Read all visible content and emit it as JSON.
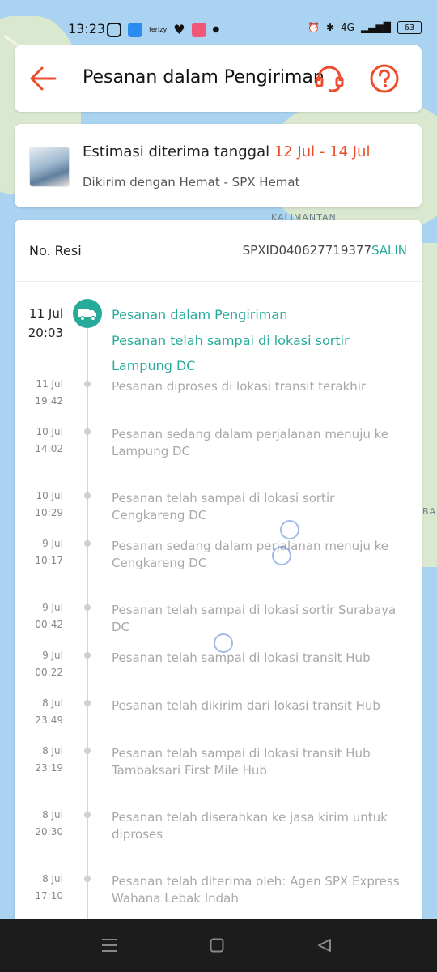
{
  "status_bar": {
    "time": "13:23",
    "network": "4G",
    "battery": "63"
  },
  "header": {
    "title": "Pesanan dalam Pengiriman"
  },
  "estimate": {
    "prefix": "Estimasi diterima tanggal",
    "date_range": "12 Jul - 14 Jul",
    "shipping": "Dikirim dengan Hemat - SPX Hemat"
  },
  "resi": {
    "label": "No. Resi",
    "number": "SPXID040627719377",
    "copy_label": "SALIN"
  },
  "current": {
    "day": "11 Jul",
    "time": "20:03",
    "status": "Pesanan dalam Pengiriman",
    "detail": "Pesanan telah sampai di lokasi sortir Lampung DC"
  },
  "events": [
    {
      "day": "11 Jul",
      "time": "19:42",
      "text": "Pesanan diproses di lokasi transit terakhir"
    },
    {
      "day": "10 Jul",
      "time": "14:02",
      "text": "Pesanan sedang dalam perjalanan  menuju ke Lampung DC"
    },
    {
      "day": "10 Jul",
      "time": "10:29",
      "text": "Pesanan telah sampai di lokasi sortir Cengkareng DC"
    },
    {
      "day": "9 Jul",
      "time": "10:17",
      "text": "Pesanan sedang dalam perjalanan  menuju ke Cengkareng DC"
    },
    {
      "day": "9 Jul",
      "time": "00:42",
      "text": "Pesanan telah sampai di lokasi sortir Surabaya DC"
    },
    {
      "day": "9 Jul",
      "time": "00:22",
      "text": "Pesanan telah sampai di lokasi transit Hub"
    },
    {
      "day": "8 Jul",
      "time": "23:49",
      "text": "Pesanan telah dikirim dari lokasi transit Hub"
    },
    {
      "day": "8 Jul",
      "time": "23:19",
      "text": "Pesanan telah sampai di lokasi transit Hub Tambaksari First Mile Hub"
    },
    {
      "day": "8 Jul",
      "time": "20:30",
      "text": "Pesanan telah diserahkan ke jasa kirim untuk diproses"
    },
    {
      "day": "8 Jul",
      "time": "17:10",
      "text": "Pesanan telah diterima oleh: Agen SPX Express Wahana Lebak Indah"
    }
  ],
  "map_labels": [
    "KALIMANTAN",
    "BA"
  ],
  "colors": {
    "accent": "#ee4d2d",
    "teal": "#26aa99",
    "muted": "#a8a8a8"
  }
}
